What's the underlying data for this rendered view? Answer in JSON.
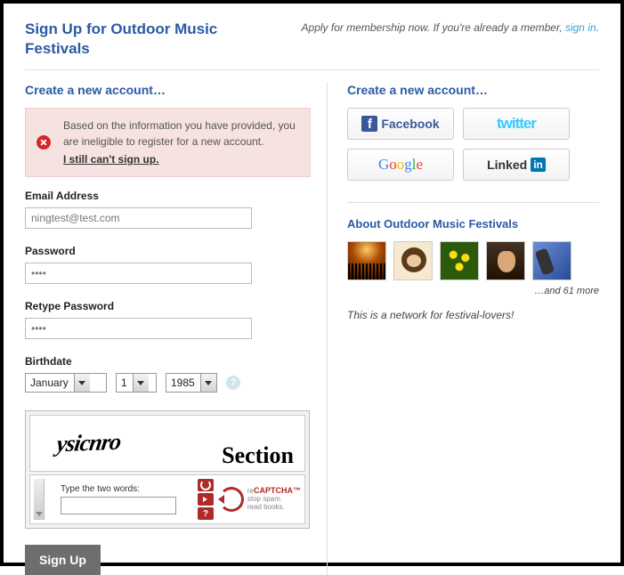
{
  "header": {
    "title": "Sign Up for Outdoor Music Festivals",
    "apply_text": "Apply for membership now. If you're already a member, ",
    "signin_label": "sign in",
    "tail": "."
  },
  "left": {
    "heading": "Create a new account…",
    "error_message": "Based on the information you have provided, you are ineligible to register for a new account.",
    "error_link": "I still can't sign up.",
    "email_label": "Email Address",
    "email_value": "ningtest@test.com",
    "password_label": "Password",
    "password_value": "••••",
    "retype_label": "Retype Password",
    "retype_value": "••••",
    "birthdate_label": "Birthdate",
    "birth_month": "January",
    "birth_day": "1",
    "birth_year": "1985",
    "captcha_word1": "ysicnro",
    "captcha_word2": "Section",
    "captcha_hint": "Type the two words:",
    "captcha_brand_prefix": "re",
    "captcha_brand": "CAPTCHA™",
    "captcha_sub1": "stop spam.",
    "captcha_sub2": "read books.",
    "signup_button": "Sign Up"
  },
  "right": {
    "heading": "Create a new account…",
    "social": {
      "facebook": "Facebook",
      "twitter": "twitter",
      "google": "Google",
      "linkedin_prefix": "Linked",
      "linkedin_box": "in"
    },
    "about_heading": "About Outdoor Music Festivals",
    "more_text": "…and 61 more",
    "about_desc": "This is a network for festival-lovers!"
  }
}
